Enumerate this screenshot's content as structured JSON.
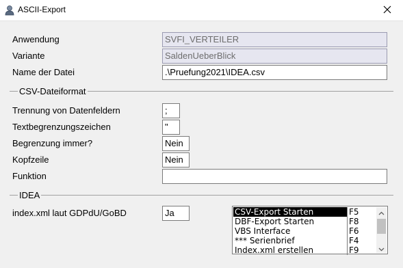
{
  "window": {
    "title": "ASCII-Export"
  },
  "fields": {
    "anwendung": {
      "label": "Anwendung",
      "value": "SVFI_VERTEILER"
    },
    "variante": {
      "label": "Variante",
      "value": "SaldenUeberBlick"
    },
    "dateiname": {
      "label": "Name der Datei",
      "value": ".\\Pruefung2021\\IDEA.csv"
    }
  },
  "csv_group": {
    "title": "CSV-Dateiformat",
    "trennung": {
      "label": "Trennung von Datenfeldern",
      "value": ";"
    },
    "textbegrenzung": {
      "label": "Textbegrenzungszeichen",
      "value": "\""
    },
    "begrenzung_immer": {
      "label": "Begrenzung immer?",
      "value": "Nein"
    },
    "kopfzeile": {
      "label": "Kopfzeile",
      "value": "Nein"
    },
    "funktion": {
      "label": "Funktion",
      "value": ""
    }
  },
  "idea_group": {
    "title": "IDEA",
    "index_xml": {
      "label": "index.xml laut GDPdU/GoBD",
      "value": "Ja"
    }
  },
  "actions": [
    {
      "label": "CSV-Export Starten",
      "key": "F5"
    },
    {
      "label": "DBF-Export Starten",
      "key": "F8"
    },
    {
      "label": "VBS Interface",
      "key": "F6"
    },
    {
      "label": "*** Serienbrief",
      "key": "F4"
    },
    {
      "label": "Index.xml erstellen",
      "key": "F9"
    }
  ],
  "selected_action_index": 0,
  "colors": {
    "readonly_bg": "#e6e6f0",
    "selection_bg": "#000000"
  }
}
